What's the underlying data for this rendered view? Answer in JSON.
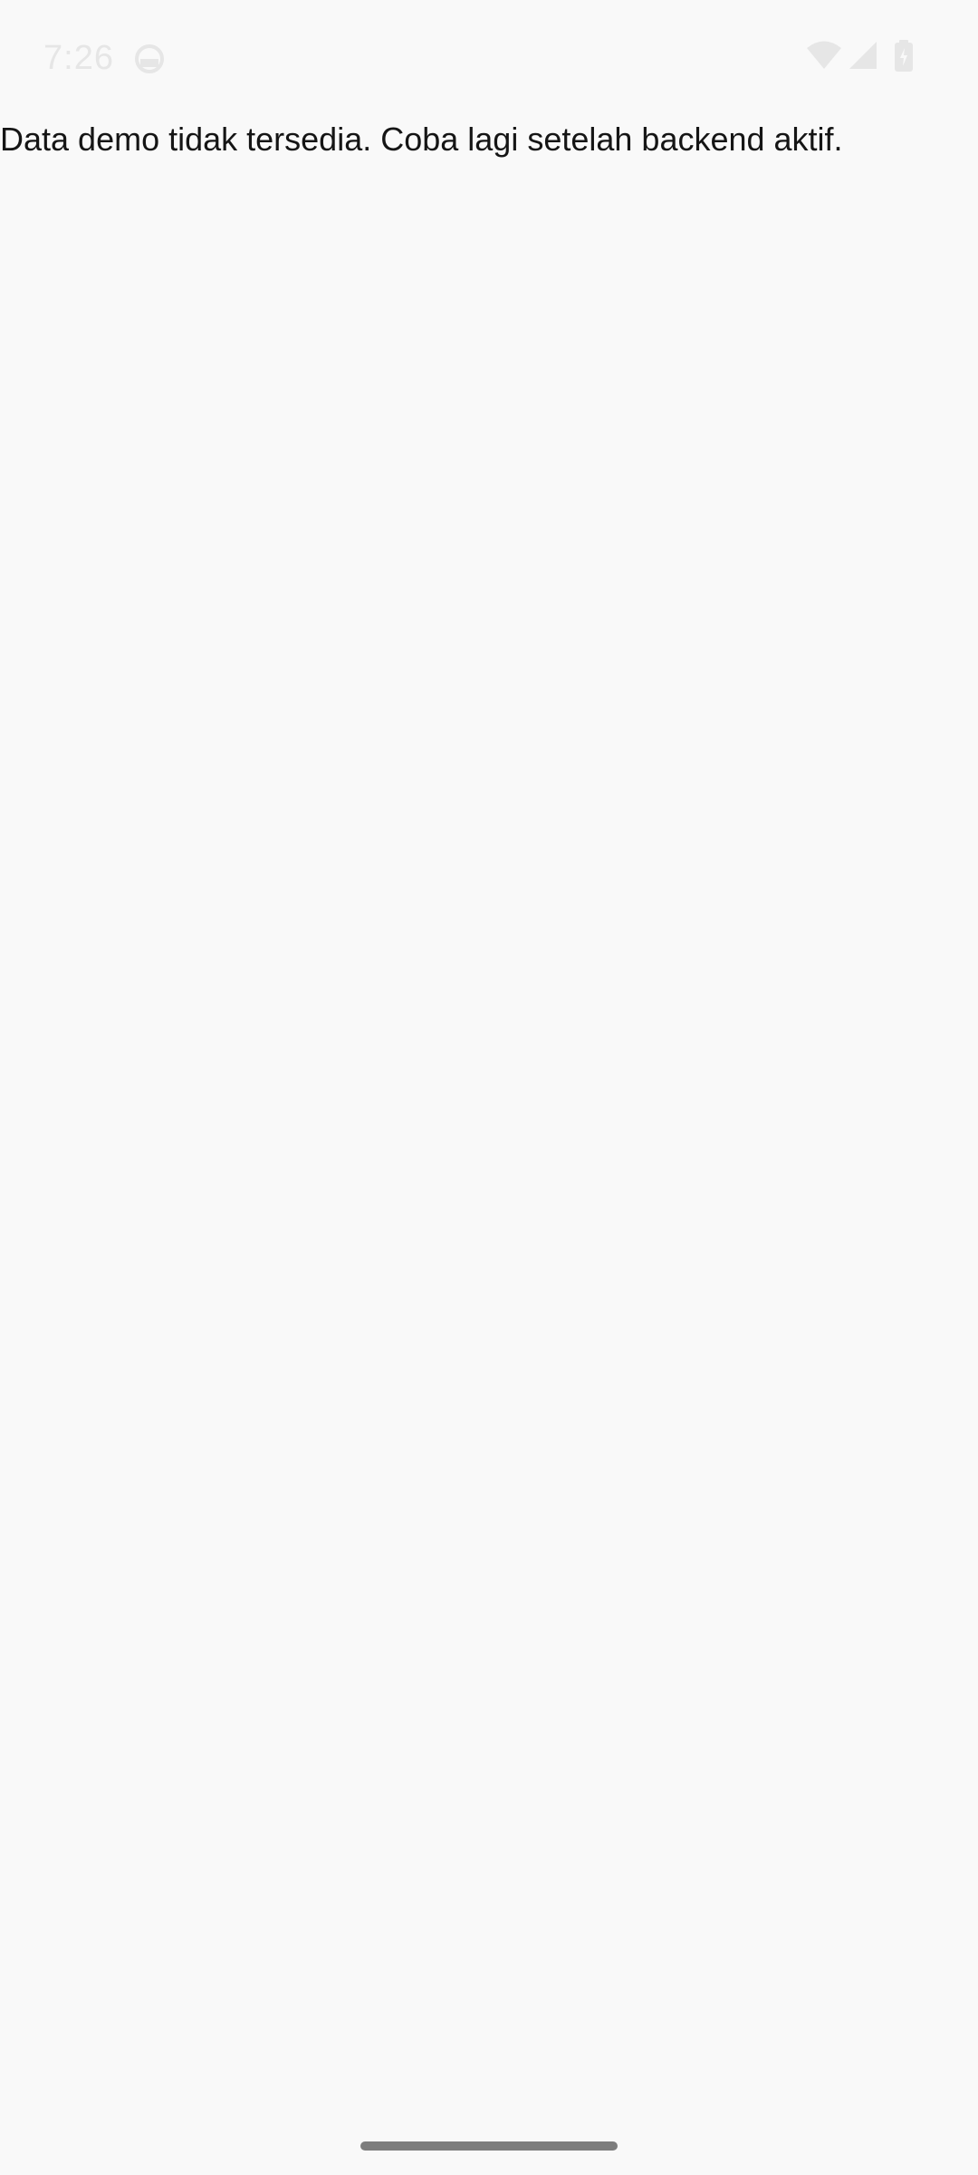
{
  "status_bar": {
    "time": "7:26",
    "app_icon": "android-head-icon",
    "wifi_icon": "wifi-icon",
    "signal_icon": "cellular-signal-icon",
    "battery_icon": "battery-icon"
  },
  "main": {
    "message": "Data demo tidak tersedia. Coba lagi setelah backend aktif."
  },
  "colors": {
    "background": "#f9f9f9",
    "text": "#151515",
    "status_icons": "#e6e6e6",
    "nav_handle": "#7d7d7d"
  }
}
